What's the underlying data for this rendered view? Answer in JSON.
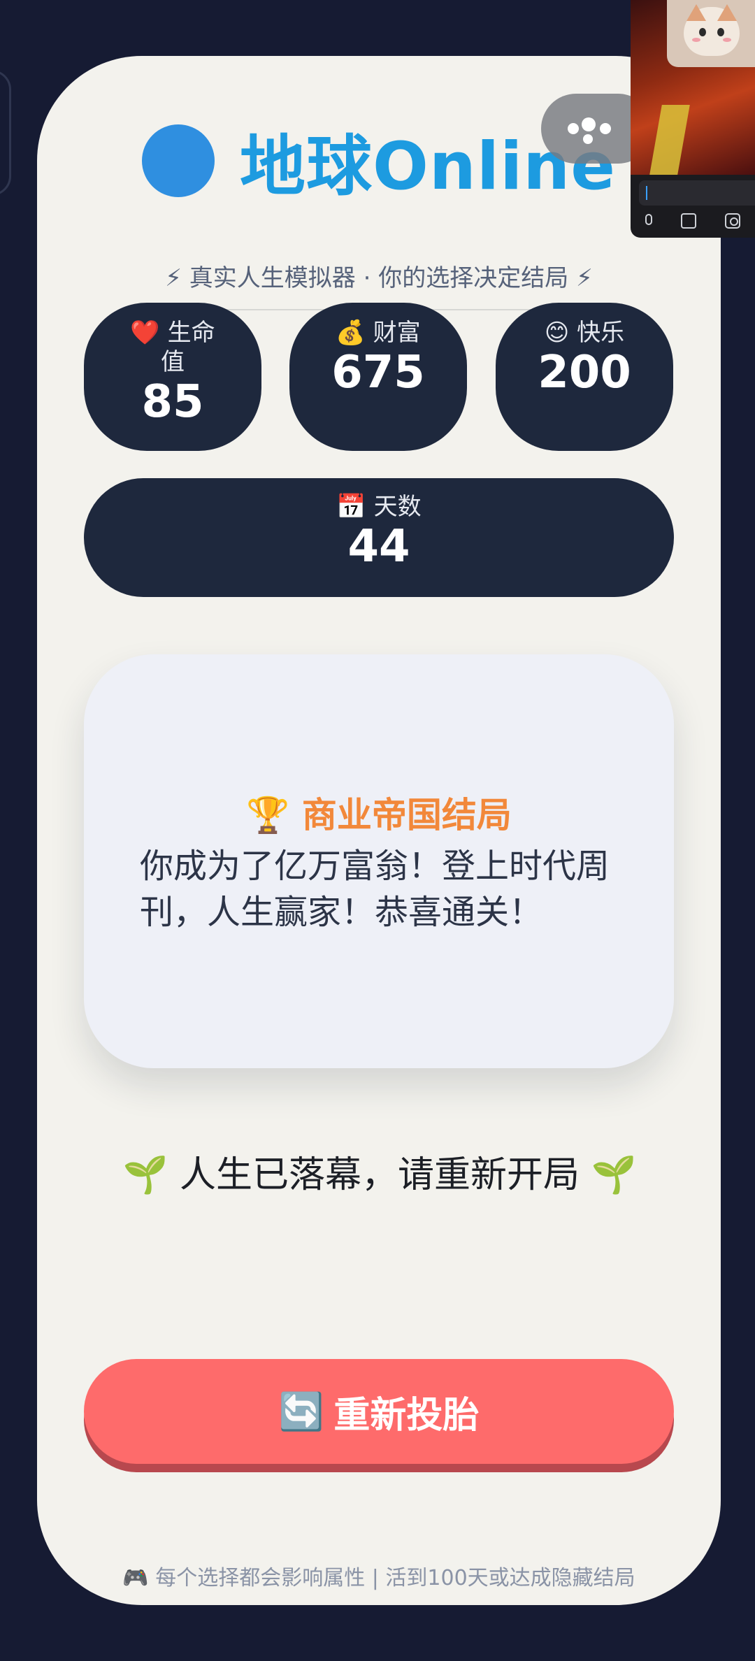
{
  "header": {
    "title": "地球Online",
    "subtitle": "⚡ 真实人生模拟器 · 你的选择决定结局 ⚡"
  },
  "stats": {
    "health": {
      "icon": "❤️",
      "label": "生命值",
      "value": "85"
    },
    "wealth": {
      "icon": "💰",
      "label": "财富",
      "value": "675"
    },
    "happiness": {
      "icon": "😊",
      "label": "快乐",
      "value": "200"
    },
    "days": {
      "icon": "📅",
      "label": "天数",
      "value": "44"
    }
  },
  "ending": {
    "icon": "🏆",
    "title": "商业帝国结局",
    "text": "你成为了亿万富翁！登上时代周刊，人生赢家！恭喜通关！"
  },
  "rebirth_message": "🌱 人生已落幕，请重新开局 🌱",
  "restart_button": {
    "icon": "🔄",
    "label": "重新投胎"
  },
  "footer": "🎮 每个选择都会影响属性 | 活到100天或达成隐藏结局",
  "colors": {
    "card_bg": "#f3f2ed",
    "stat_bg": "#1e283d",
    "title_blue": "#1d9be0",
    "ending_orange": "#f2883a",
    "button_red": "#fe6b6b",
    "page_bg": "#161b33"
  }
}
